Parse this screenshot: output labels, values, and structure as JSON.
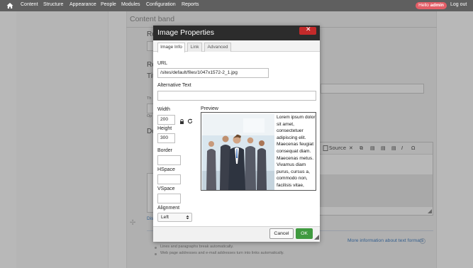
{
  "toolbar": {
    "home_icon": "home-icon",
    "items": [
      "Content",
      "Structure",
      "Appearance",
      "People",
      "Modules",
      "Configuration",
      "Reports"
    ],
    "hello_prefix": "Hello",
    "hello_user": "admin",
    "logout": "Log out",
    "hello_bg": "#e35e67"
  },
  "background": {
    "page_title": "Content band",
    "label_ro": "Ro",
    "label_re": "Re",
    "label_tit": "Tit",
    "label_th": "Th",
    "label_op": "Op",
    "label_do": "Do",
    "editor_source": "Source",
    "link_short": "Dis",
    "notes": [
      "Lines and paragraphs break automatically.",
      "Web page addresses and e-mail addresses turn into links automatically."
    ],
    "help_link": "More information about text formats"
  },
  "dialog": {
    "title": "Image Properties",
    "close_icon": "close-icon",
    "tabs": [
      "Image Info",
      "Link",
      "Advanced"
    ],
    "active_tab": "Image Info",
    "url_label": "URL",
    "url_value": "/sites/default/files/1047x1572-2_1.jpg",
    "alt_label": "Alternative Text",
    "alt_value": "",
    "width_label": "Width",
    "width_value": "200",
    "height_label": "Height",
    "height_value": "300",
    "lock_icon": "lock-icon",
    "reset_icon": "reset-icon",
    "border_label": "Border",
    "border_value": "",
    "hspace_label": "HSpace",
    "hspace_value": "",
    "vspace_label": "VSpace",
    "vspace_value": "",
    "alignment_label": "Alignment",
    "alignment_value": "Left",
    "preview_label": "Preview",
    "preview_text": "Lorem ipsum dolor sit amet, consectetuer adipiscing elit. Maecenas feugiat consequat diam. Maecenas metus. Vivamus diam purus, cursus a, commodo non, facilisis vitae, nulla. Aenean",
    "cancel_label": "Cancel",
    "ok_label": "OK",
    "ok_color": "#3f9a3f",
    "title_bar_color": "#2c2c2c",
    "close_color": "#c32a2a"
  }
}
